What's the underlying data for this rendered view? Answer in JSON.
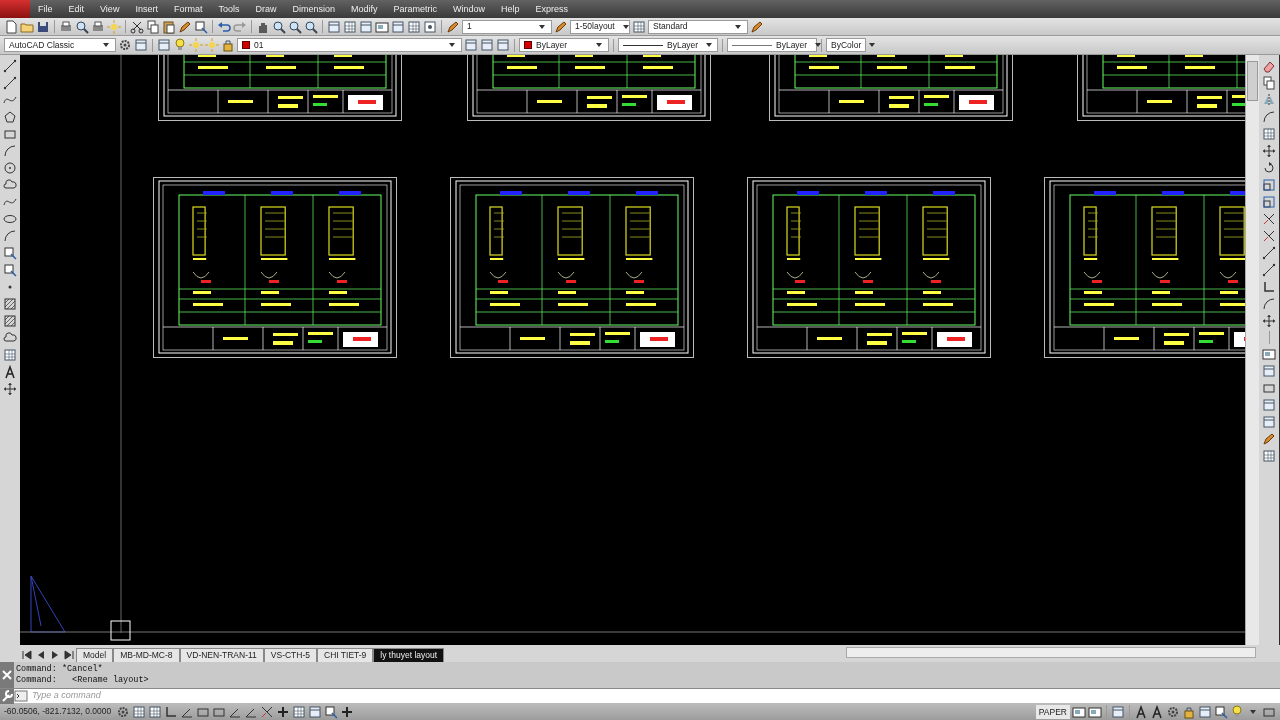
{
  "menu": [
    "File",
    "Edit",
    "View",
    "Insert",
    "Format",
    "Tools",
    "Draw",
    "Dimension",
    "Modify",
    "Parametric",
    "Window",
    "Help",
    "Express"
  ],
  "annotation_combos": [
    {
      "value": "1"
    },
    {
      "value": "1-50layout"
    },
    {
      "value": "Standard"
    }
  ],
  "workspace": "AutoCAD Classic",
  "layer": "01",
  "properties": [
    {
      "kind": "color",
      "value": "ByLayer"
    },
    {
      "kind": "linetype",
      "value": "ByLayer"
    },
    {
      "kind": "lineweight",
      "value": "ByLayer"
    },
    {
      "kind": "plotstyle",
      "value": "ByColor"
    }
  ],
  "layout_tabs": [
    {
      "label": "Model",
      "selected": false
    },
    {
      "label": "MB-MD-MC-8",
      "selected": false
    },
    {
      "label": "VD-NEN-TRAN-11",
      "selected": false
    },
    {
      "label": "VS-CTH-5",
      "selected": false
    },
    {
      "label": "CHI TIET-9",
      "selected": false
    },
    {
      "label": "ly thuyet layout",
      "selected": true
    }
  ],
  "command_history": [
    "Command: *Cancel*",
    "Command:   <Rename layout>"
  ],
  "command_input": {
    "placeholder": "Type a command"
  },
  "status": {
    "coordinates": "-60.0506, -821.7132, 0.0000",
    "space": "PAPER"
  }
}
